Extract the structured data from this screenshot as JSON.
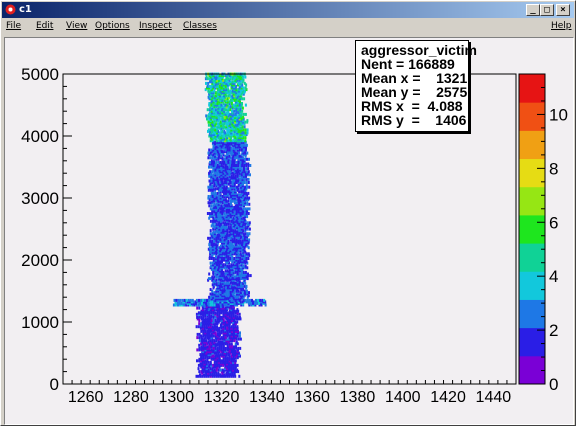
{
  "window": {
    "title": "c1",
    "buttons": [
      "_",
      "□",
      "×"
    ]
  },
  "menu": {
    "items": [
      "File",
      "Edit",
      "View",
      "Options",
      "Inspect",
      "Classes"
    ],
    "help": "Help"
  },
  "stats": {
    "title": "aggressor_victim",
    "entries_label": "Nent = 166889",
    "mean_x_label": "Mean x =    1321",
    "mean_y_label": "Mean y =    2575",
    "rms_x_label": "RMS x  =  4.088",
    "rms_y_label": "RMS y  =    1406"
  },
  "chart_data": {
    "type": "heatmap",
    "title": "",
    "xlabel": "",
    "ylabel": "",
    "xlim": [
      1250,
      1450
    ],
    "ylim": [
      0,
      5000
    ],
    "x_ticks": [
      1260,
      1280,
      1300,
      1320,
      1340,
      1360,
      1380,
      1400,
      1420,
      1440
    ],
    "y_ticks": [
      0,
      1000,
      2000,
      3000,
      4000,
      5000
    ],
    "z_ticks": [
      0,
      2,
      4,
      6,
      8,
      10
    ],
    "zlim": [
      0,
      11.5
    ],
    "colors": {
      "palette": [
        "#7a00d6",
        "#2a1ee6",
        "#1e78e6",
        "#12c8dc",
        "#10d296",
        "#1ee61e",
        "#96e614",
        "#e6dc14",
        "#f0a014",
        "#f05014",
        "#e61414"
      ]
    },
    "bands": [
      {
        "y": [
          100,
          1350
        ],
        "x": [
          1310,
          1327
        ],
        "level": 1.5
      },
      {
        "y": [
          1250,
          1350
        ],
        "x": [
          1300,
          1340
        ],
        "level": 2.5
      },
      {
        "y": [
          1350,
          3900
        ],
        "x": [
          1315,
          1331
        ],
        "level": 2.0
      },
      {
        "y": [
          3900,
          5000
        ],
        "x": [
          1314,
          1330
        ],
        "level": 4.0
      }
    ],
    "stats": {
      "entries": 166889,
      "mean_x": 1321,
      "mean_y": 2575,
      "rms_x": 4.088,
      "rms_y": 1406
    }
  }
}
